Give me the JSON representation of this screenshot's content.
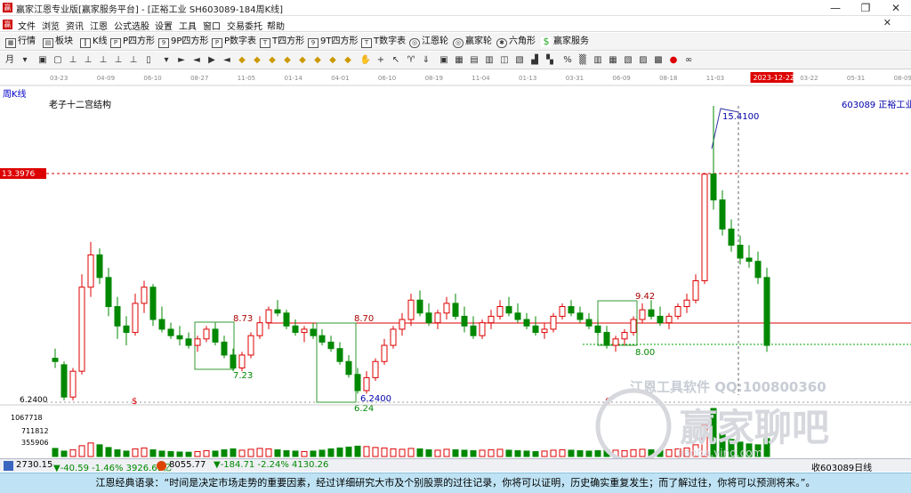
{
  "window": {
    "title": "赢家江恩专业版[赢家服务平台] - [正裕工业  SH603089-184周K线]",
    "minimize": "—",
    "maximize": "❐",
    "close": "✕"
  },
  "menu": [
    "文件",
    "浏览",
    "资讯",
    "江恩",
    "公式选股",
    "设置",
    "工具",
    "窗口",
    "交易委托",
    "帮助"
  ],
  "toolbar": [
    "行情",
    "板块",
    "K线",
    "P四方形",
    "9P四方形",
    "P数字表",
    "T四方形",
    "9T四方形",
    "T数字表",
    "江恩轮",
    "赢家轮",
    "六角形",
    "赢家服务"
  ],
  "chart_data": {
    "type": "candlestick",
    "period_label": "周K线",
    "indicator_label": "老子十二宫结构",
    "stock_label": "603089 正裕工业",
    "date_ticks": [
      "03-23",
      "04-09",
      "06-10",
      "08-27",
      "11-05",
      "01-14",
      "04-01",
      "06-10",
      "08-19",
      "11-04",
      "01-13",
      "03-31",
      "06-09",
      "08-18",
      "11-03",
      "2023-12-22",
      "03-22",
      "05-31",
      "08-09"
    ],
    "price_axis": {
      "top_label": "13.3976",
      "bottom_label": "6.2400"
    },
    "annotations": [
      "15.4100",
      "8.73",
      "7.23",
      "8.70",
      "6.2400",
      "6.24",
      "9.42",
      "8.00",
      "$",
      "$"
    ],
    "volume_axis": [
      "1067718",
      "711812",
      "355906"
    ],
    "ylim": [
      6.24,
      15.41
    ],
    "candles": [
      [
        7.6,
        7.9,
        7.3,
        7.5
      ],
      [
        7.4,
        7.5,
        6.3,
        6.4
      ],
      [
        6.4,
        7.3,
        6.3,
        7.2
      ],
      [
        7.2,
        10.2,
        7.1,
        9.8
      ],
      [
        9.8,
        11.2,
        9.5,
        10.8
      ],
      [
        10.8,
        11.0,
        9.9,
        10.1
      ],
      [
        10.1,
        10.4,
        8.9,
        9.2
      ],
      [
        9.2,
        9.5,
        8.2,
        8.6
      ],
      [
        8.6,
        8.9,
        8.0,
        8.4
      ],
      [
        8.4,
        9.6,
        8.3,
        9.3
      ],
      [
        9.3,
        10.0,
        9.0,
        9.8
      ],
      [
        9.8,
        9.9,
        8.6,
        8.8
      ],
      [
        8.8,
        9.2,
        8.4,
        8.5
      ],
      [
        8.5,
        8.7,
        8.2,
        8.3
      ],
      [
        8.3,
        8.6,
        8.0,
        8.2
      ],
      [
        8.2,
        8.4,
        7.9,
        8.0
      ],
      [
        8.0,
        8.3,
        7.8,
        8.2
      ],
      [
        8.2,
        8.6,
        8.1,
        8.5
      ],
      [
        8.5,
        8.7,
        8.0,
        8.1
      ],
      [
        8.1,
        8.3,
        7.6,
        7.7
      ],
      [
        7.7,
        7.9,
        7.2,
        7.3
      ],
      [
        7.3,
        7.8,
        7.2,
        7.7
      ],
      [
        7.7,
        8.4,
        7.6,
        8.3
      ],
      [
        8.3,
        8.9,
        8.2,
        8.7
      ],
      [
        8.7,
        9.2,
        8.5,
        9.1
      ],
      [
        9.1,
        9.4,
        8.9,
        9.0
      ],
      [
        9.0,
        9.1,
        8.5,
        8.6
      ],
      [
        8.6,
        8.8,
        8.3,
        8.4
      ],
      [
        8.4,
        8.6,
        8.1,
        8.5
      ],
      [
        8.5,
        8.7,
        8.2,
        8.3
      ],
      [
        8.3,
        8.5,
        8.0,
        8.1
      ],
      [
        8.1,
        8.3,
        7.8,
        7.9
      ],
      [
        7.9,
        8.1,
        7.4,
        7.5
      ],
      [
        7.5,
        7.7,
        7.0,
        7.1
      ],
      [
        7.1,
        7.3,
        6.5,
        6.6
      ],
      [
        6.6,
        7.2,
        6.5,
        7.0
      ],
      [
        7.0,
        7.6,
        6.9,
        7.5
      ],
      [
        7.5,
        8.2,
        7.4,
        8.0
      ],
      [
        8.0,
        8.6,
        7.9,
        8.5
      ],
      [
        8.5,
        9.0,
        8.3,
        8.8
      ],
      [
        8.8,
        9.6,
        8.6,
        9.4
      ],
      [
        9.4,
        9.7,
        8.9,
        9.0
      ],
      [
        9.0,
        9.3,
        8.6,
        8.7
      ],
      [
        8.7,
        9.1,
        8.5,
        9.0
      ],
      [
        9.0,
        9.5,
        8.8,
        9.3
      ],
      [
        9.3,
        9.6,
        8.8,
        8.9
      ],
      [
        8.9,
        9.2,
        8.4,
        8.6
      ],
      [
        8.6,
        8.9,
        8.2,
        8.3
      ],
      [
        8.3,
        8.8,
        8.2,
        8.7
      ],
      [
        8.7,
        9.1,
        8.5,
        8.9
      ],
      [
        8.9,
        9.4,
        8.8,
        9.2
      ],
      [
        9.2,
        9.5,
        8.9,
        9.0
      ],
      [
        9.0,
        9.3,
        8.7,
        8.8
      ],
      [
        8.8,
        9.0,
        8.5,
        8.6
      ],
      [
        8.6,
        8.9,
        8.3,
        8.4
      ],
      [
        8.4,
        8.7,
        8.2,
        8.5
      ],
      [
        8.5,
        9.0,
        8.4,
        8.9
      ],
      [
        8.9,
        9.3,
        8.8,
        9.2
      ],
      [
        9.2,
        9.4,
        8.9,
        9.0
      ],
      [
        9.0,
        9.2,
        8.7,
        8.8
      ],
      [
        8.8,
        9.0,
        8.5,
        8.6
      ],
      [
        8.6,
        8.8,
        8.3,
        8.4
      ],
      [
        8.4,
        8.6,
        7.9,
        8.0
      ],
      [
        8.0,
        8.3,
        7.8,
        8.2
      ],
      [
        8.2,
        8.5,
        8.0,
        8.4
      ],
      [
        8.4,
        8.9,
        8.3,
        8.8
      ],
      [
        8.8,
        9.3,
        8.7,
        9.1
      ],
      [
        9.1,
        9.4,
        8.8,
        8.9
      ],
      [
        8.9,
        9.2,
        8.6,
        8.7
      ],
      [
        8.7,
        9.0,
        8.5,
        8.9
      ],
      [
        8.9,
        9.3,
        8.8,
        9.2
      ],
      [
        9.2,
        9.6,
        9.0,
        9.4
      ],
      [
        9.4,
        10.2,
        9.3,
        10.0
      ],
      [
        10.0,
        12.0,
        9.9,
        13.3
      ],
      [
        13.3,
        15.41,
        12.2,
        12.5
      ],
      [
        12.5,
        12.8,
        11.4,
        11.6
      ],
      [
        11.6,
        11.9,
        10.9,
        11.1
      ],
      [
        11.1,
        11.4,
        10.5,
        10.7
      ],
      [
        10.7,
        11.1,
        10.4,
        10.6
      ],
      [
        10.6,
        10.9,
        9.9,
        10.1
      ],
      [
        10.1,
        10.4,
        7.8,
        8.0
      ]
    ],
    "volumes": [
      180,
      120,
      150,
      240,
      300,
      260,
      200,
      150,
      120,
      170,
      190,
      150,
      120,
      110,
      100,
      95,
      110,
      130,
      120,
      150,
      170,
      140,
      160,
      180,
      170,
      150,
      130,
      120,
      110,
      120,
      140,
      170,
      190,
      210,
      230,
      220,
      200,
      190,
      170,
      160,
      180,
      170,
      150,
      140,
      160,
      150,
      140,
      130,
      140,
      150,
      160,
      140,
      130,
      120,
      110,
      120,
      140,
      150,
      140,
      130,
      120,
      130,
      150,
      140,
      130,
      150,
      160,
      150,
      140,
      150,
      170,
      190,
      260,
      700,
      1067,
      520,
      380,
      320,
      280,
      260,
      400
    ]
  },
  "status": {
    "idx1": "2730.15",
    "chg1": "▼-40.59 -1.46% 3926.61亿",
    "idx2": "8055.77",
    "chg2": "▼-184.71 -2.24% 4130.26",
    "right": "收603089日线"
  },
  "watermark": {
    "line1": "江恩工具软件  QQ:100800360",
    "line2": "赢家聊吧",
    "url": "jiaoba.ying.com"
  },
  "quote": "江恩经典语录：“时间是决定市场走势的重要因素，经过详细研究大市及个别股票的过往记录，你将可以证明，历史确实重复发生；而了解过往，你将可以预测将来。”。"
}
